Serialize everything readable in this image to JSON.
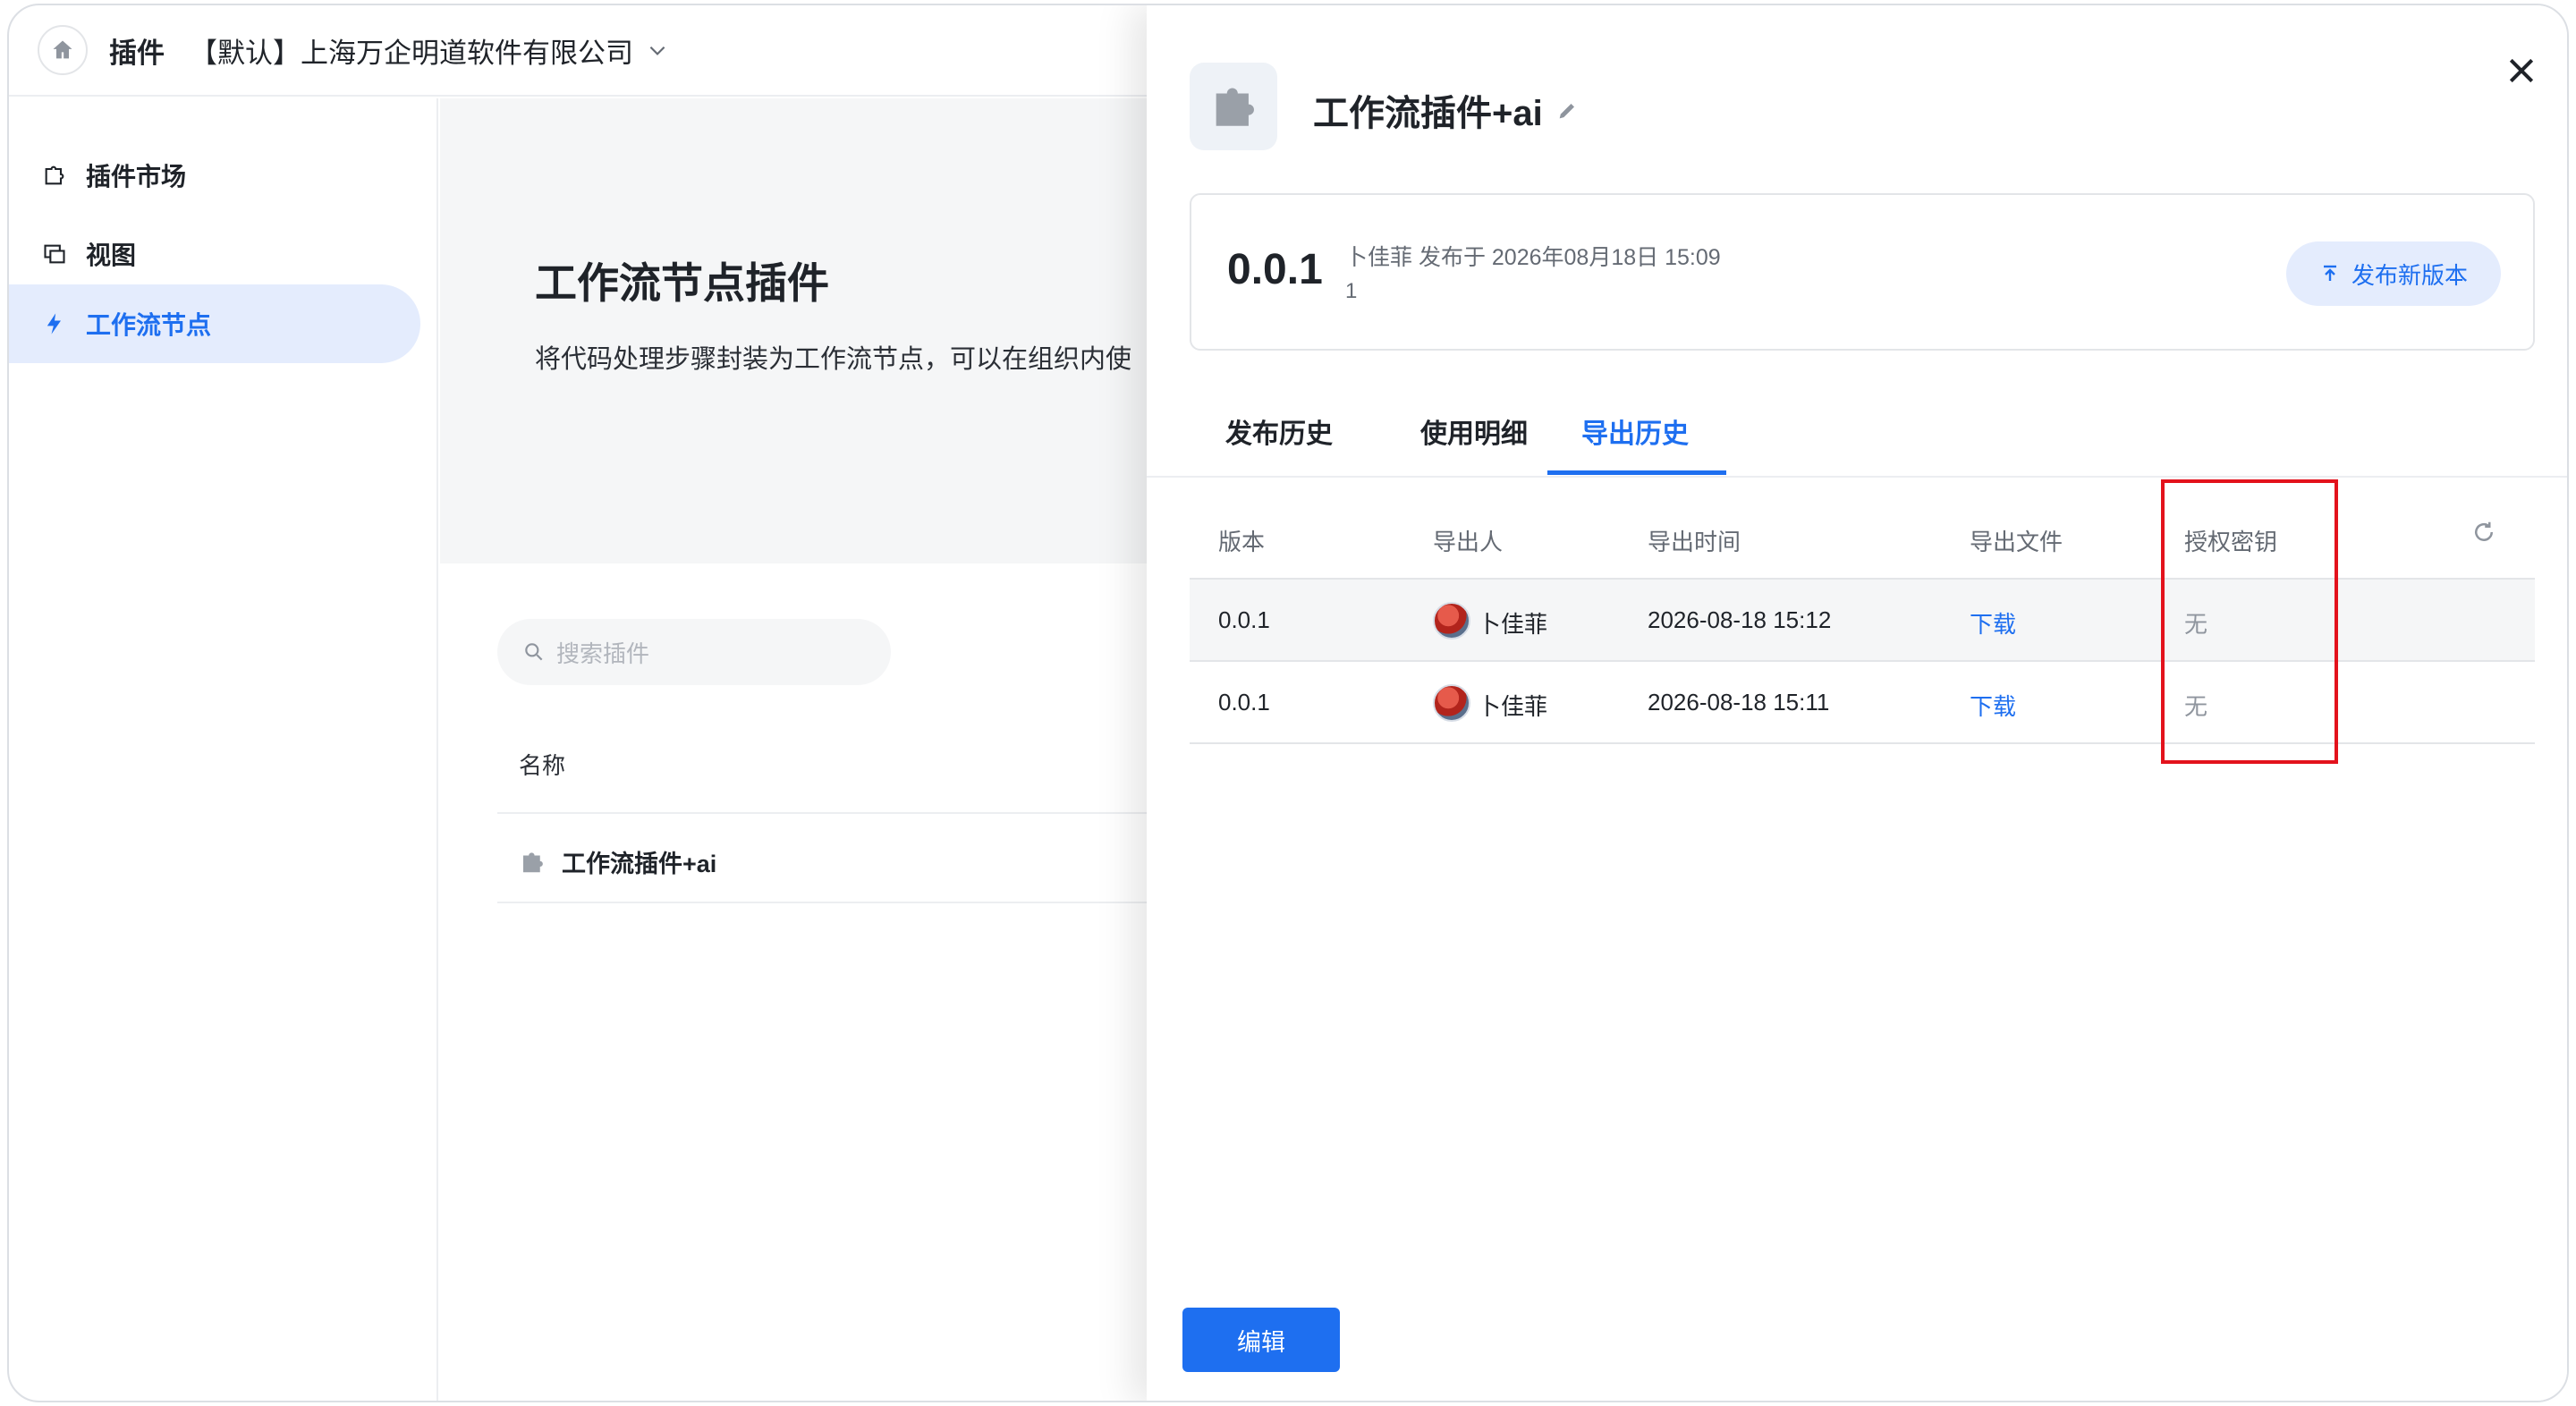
{
  "topbar": {
    "app_title": "插件",
    "org_name": "【默认】上海万企明道软件有限公司"
  },
  "sidebar": {
    "items": [
      {
        "label": "插件市场",
        "icon": "plugin-market-icon"
      },
      {
        "label": "视图",
        "icon": "view-icon"
      },
      {
        "label": "工作流节点",
        "icon": "workflow-node-icon"
      }
    ]
  },
  "main": {
    "title": "工作流节点插件",
    "description": "将代码处理步骤封装为工作流节点，可以在组织内使",
    "search_placeholder": "搜索插件",
    "column_name": "名称",
    "plugins": [
      {
        "name": "工作流插件+ai"
      }
    ]
  },
  "drawer": {
    "title": "工作流插件+ai",
    "version_card": {
      "version": "0.0.1",
      "meta": "卜佳菲 发布于 2026年08月18日 15:09",
      "note": "1",
      "publish_button": "发布新版本"
    },
    "tabs": [
      "发布历史",
      "使用明细",
      "导出历史"
    ],
    "active_tab": "导出历史",
    "table": {
      "headers": [
        "版本",
        "导出人",
        "导出时间",
        "导出文件",
        "授权密钥"
      ],
      "rows": [
        {
          "version": "0.0.1",
          "user": "卜佳菲",
          "time": "2026-08-18 15:12",
          "file": "下载",
          "key": "无"
        },
        {
          "version": "0.0.1",
          "user": "卜佳菲",
          "time": "2026-08-18 15:11",
          "file": "下载",
          "key": "无"
        }
      ]
    },
    "edit_button": "编辑"
  },
  "colors": {
    "accent": "#1e6ff0",
    "accent_light": "#e4ecfd",
    "highlight_box": "#e3121c",
    "muted_text": "#646a73"
  }
}
